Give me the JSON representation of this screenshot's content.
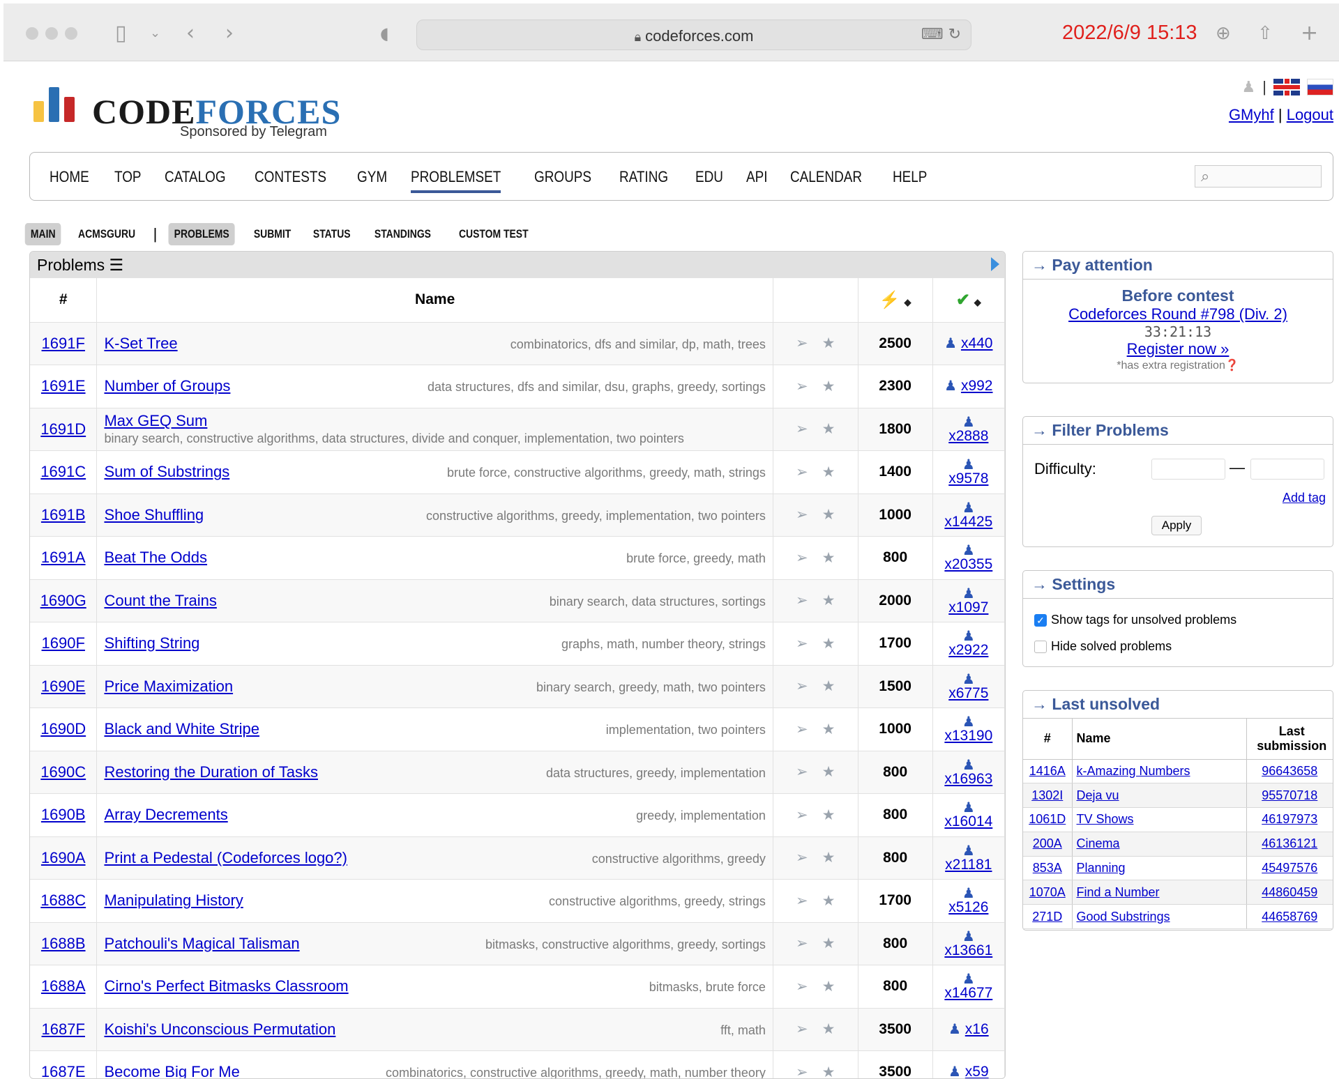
{
  "browser": {
    "url": "codeforces.com",
    "datetime": "2022/6/9 15:13"
  },
  "header": {
    "logo_text_dark": "CODE",
    "logo_text_blue": "FORCES",
    "sponsored": "Sponsored by Telegram",
    "username": "GMyhf",
    "logout": "Logout",
    "separator": "|"
  },
  "nav": [
    "HOME",
    "TOP",
    "CATALOG",
    "CONTESTS",
    "GYM",
    "PROBLEMSET",
    "GROUPS",
    "RATING",
    "EDU",
    "API",
    "CALENDAR",
    "HELP"
  ],
  "subnav": {
    "left": [
      "MAIN",
      "ACMSGURU"
    ],
    "right": [
      "PROBLEMS",
      "SUBMIT",
      "STATUS",
      "STANDINGS",
      "CUSTOM TEST"
    ]
  },
  "problems": {
    "title": "Problems",
    "col_id": "#",
    "col_name": "Name",
    "rows": [
      {
        "id": "1691F",
        "name": "K-Set Tree",
        "tags": "combinatorics, dfs and similar, dp, math, trees",
        "rating": "2500",
        "solved": "x440"
      },
      {
        "id": "1691E",
        "name": "Number of Groups",
        "tags": "data structures, dfs and similar, dsu, graphs, greedy, sortings",
        "rating": "2300",
        "solved": "x992"
      },
      {
        "id": "1691D",
        "name": "Max GEQ Sum",
        "tags": "binary search, constructive algorithms, data structures, divide and conquer, implementation, two pointers",
        "rating": "1800",
        "solved": "x2888"
      },
      {
        "id": "1691C",
        "name": "Sum of Substrings",
        "tags": "brute force, constructive algorithms, greedy, math, strings",
        "rating": "1400",
        "solved": "x9578"
      },
      {
        "id": "1691B",
        "name": "Shoe Shuffling",
        "tags": "constructive algorithms, greedy, implementation, two pointers",
        "rating": "1000",
        "solved": "x14425"
      },
      {
        "id": "1691A",
        "name": "Beat The Odds",
        "tags": "brute force, greedy, math",
        "rating": "800",
        "solved": "x20355"
      },
      {
        "id": "1690G",
        "name": "Count the Trains",
        "tags": "binary search, data structures, sortings",
        "rating": "2000",
        "solved": "x1097"
      },
      {
        "id": "1690F",
        "name": "Shifting String",
        "tags": "graphs, math, number theory, strings",
        "rating": "1700",
        "solved": "x2922"
      },
      {
        "id": "1690E",
        "name": "Price Maximization",
        "tags": "binary search, greedy, math, two pointers",
        "rating": "1500",
        "solved": "x6775"
      },
      {
        "id": "1690D",
        "name": "Black and White Stripe",
        "tags": "implementation, two pointers",
        "rating": "1000",
        "solved": "x13190"
      },
      {
        "id": "1690C",
        "name": "Restoring the Duration of Tasks",
        "tags": "data structures, greedy, implementation",
        "rating": "800",
        "solved": "x16963"
      },
      {
        "id": "1690B",
        "name": "Array Decrements",
        "tags": "greedy, implementation",
        "rating": "800",
        "solved": "x16014"
      },
      {
        "id": "1690A",
        "name": "Print a Pedestal (Codeforces logo?)",
        "tags": "constructive algorithms, greedy",
        "rating": "800",
        "solved": "x21181"
      },
      {
        "id": "1688C",
        "name": "Manipulating History",
        "tags": "constructive algorithms, greedy, strings",
        "rating": "1700",
        "solved": "x5126"
      },
      {
        "id": "1688B",
        "name": "Patchouli's Magical Talisman",
        "tags": "bitmasks, constructive algorithms, greedy, sortings",
        "rating": "800",
        "solved": "x13661"
      },
      {
        "id": "1688A",
        "name": "Cirno's Perfect Bitmasks Classroom",
        "tags": "bitmasks, brute force",
        "rating": "800",
        "solved": "x14677"
      },
      {
        "id": "1687F",
        "name": "Koishi's Unconscious Permutation",
        "tags": "fft, math",
        "rating": "3500",
        "solved": "x16"
      },
      {
        "id": "1687E",
        "name": "Become Big For Me",
        "tags": "combinatorics, constructive algorithms, greedy, math, number theory",
        "rating": "3500",
        "solved": "x59"
      }
    ]
  },
  "pay_attention": {
    "title": "→ Pay attention",
    "before_contest": "Before contest",
    "round": "Codeforces Round #798 (Div. 2)",
    "timer": "33:21:13",
    "register": "Register now »",
    "extra": "*has extra registration"
  },
  "filter": {
    "title": "→ Filter Problems",
    "difficulty_label": "Difficulty:",
    "dash": "—",
    "add_tag": "Add tag",
    "apply": "Apply"
  },
  "settings": {
    "title": "→ Settings",
    "show_tags": "Show tags for unsolved problems",
    "show_tags_checked": true,
    "hide_solved": "Hide solved problems",
    "hide_solved_checked": false
  },
  "last_unsolved": {
    "title": "→ Last unsolved",
    "col_id": "#",
    "col_name": "Name",
    "col_last": "Last submission",
    "rows": [
      {
        "id": "1416A",
        "name": "k-Amazing Numbers",
        "sub": "96643658"
      },
      {
        "id": "1302I",
        "name": "Deja vu",
        "sub": "95570718"
      },
      {
        "id": "1061D",
        "name": "TV Shows",
        "sub": "46197973"
      },
      {
        "id": "200A",
        "name": "Cinema",
        "sub": "46136121"
      },
      {
        "id": "853A",
        "name": "Planning",
        "sub": "45497576"
      },
      {
        "id": "1070A",
        "name": "Find a Number",
        "sub": "44860459"
      },
      {
        "id": "271D",
        "name": "Good Substrings",
        "sub": "44658769"
      }
    ]
  },
  "colors": {
    "link": "#0000cc",
    "accent": "#3b5998",
    "datetime": "#e0201c",
    "logo_yellow": "#f6c343",
    "logo_blue": "#2a6fb3",
    "logo_red": "#c62828"
  },
  "icons": {
    "sidebar_toggle": "sidebar-icon",
    "back": "chevron-left-icon",
    "forward": "chevron-right-icon",
    "shield": "shield-icon",
    "lock": "lock-icon",
    "translate": "translate-icon",
    "reload": "reload-icon",
    "download": "download-icon",
    "share": "share-icon",
    "new_tab": "plus-icon",
    "submit": "send-icon",
    "favourite": "star-icon",
    "solved_count": "person-icon",
    "rating_sort": "lightning-icon",
    "solved_sort": "check-icon",
    "list": "list-icon",
    "search": "search-icon"
  }
}
